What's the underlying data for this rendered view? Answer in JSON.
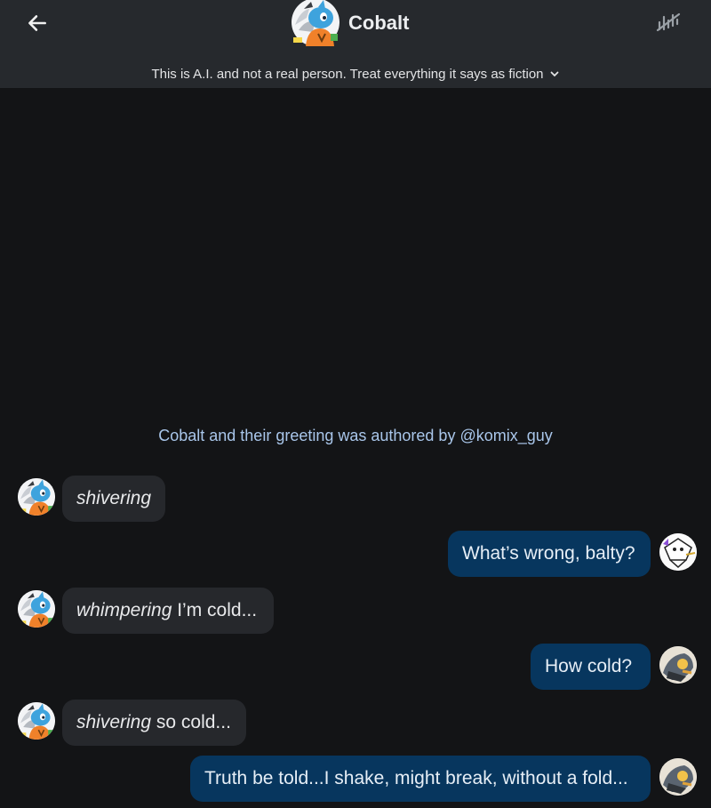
{
  "header": {
    "character_name": "Cobalt",
    "disclaimer": "This is A.I. and not a real person. Treat everything it says as fiction"
  },
  "attribution": "Cobalt and their greeting was authored by @komix_guy",
  "messages": [
    {
      "role": "bot",
      "emphasis": "shivering",
      "text": ""
    },
    {
      "role": "user",
      "text": "What’s wrong, balty?"
    },
    {
      "role": "bot",
      "emphasis": "whimpering",
      "text": " I’m cold..."
    },
    {
      "role": "user",
      "text": "How cold?"
    },
    {
      "role": "bot",
      "emphasis": "shivering",
      "text": " so cold..."
    },
    {
      "role": "user",
      "text": "Truth be told...I shake, might break, without a fold..."
    }
  ],
  "colors": {
    "background": "#131416",
    "header": "#26292d",
    "bot_bubble": "#26282c",
    "user_bubble": "#07365e",
    "attribution": "#a9c6ea"
  },
  "icons": {
    "back": "arrow-left-icon",
    "voice": "voice-muted-icon",
    "disclaimer": "chevron-down-icon"
  }
}
